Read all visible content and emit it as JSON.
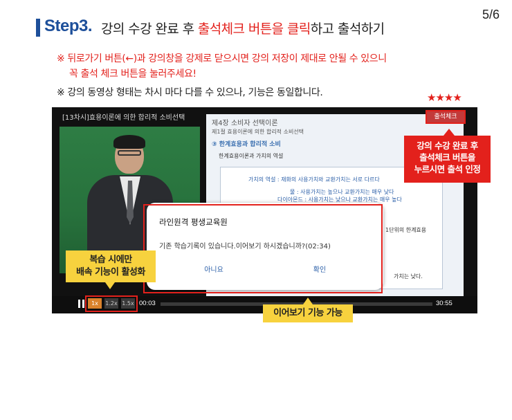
{
  "header": {
    "step_label": "Step3.",
    "title_before": "강의 수강 완료 후 ",
    "title_highlight": "출석체크 버튼을 클릭",
    "title_after": "하고 출석하기",
    "page_number": "5/6"
  },
  "notes": {
    "warning_line1": "※ 뒤로가기 버튼(←)과 강의창을 강제로 닫으시면 강의 저장이 제대로 안될 수 있으니",
    "warning_line2": "꼭 출석 체크 버튼을 눌러주세요!",
    "info": "※ 강의 동영상 형태는 차시 마다 다를 수 있으나, 기능은 동일합니다."
  },
  "stars": "★★★★",
  "player": {
    "video_title": "[13차시]효용이론에 의한 합리적 소비선택",
    "checkin_button": "출석체크",
    "slide": {
      "chapter": "제4장 소비자 선택이론",
      "section_title": "제1절 효용이론에 의한 합리적 소비선택",
      "heading": "③ 한계효용과 합리적 소비",
      "subheading": "한계효용이론과 가치의 역설",
      "line1": "가치의 역설 : 재화의 사용가치와 교환가치는 서로 다르다",
      "line2": "물 : 사용가치는 높으나 교환가치는 매우 낮다",
      "line3": "다이아몬드 : 사용가치는 낮으나 교환가치는 매우 높다",
      "line4": "1단위의 한계효용",
      "line5": "가치는 낮다."
    },
    "dialog": {
      "title": "라인원격 평생교육원",
      "message": "기존 학습기록이 있습니다.이어보기 하시겠습니까?(02:34)",
      "no_label": "아니요",
      "ok_label": "확인"
    },
    "controls": {
      "speeds": [
        "1x",
        "1.2x",
        "1.5x"
      ],
      "active_speed": "1x",
      "current_time": "00:03",
      "total_time": "30:55",
      "progress_fraction": 0.0
    }
  },
  "callouts": {
    "checkin_line1": "강의 수강 완료 후",
    "checkin_line2": "출석체크 버튼을",
    "checkin_line3": "누르시면 출석 인정",
    "review_line1": "복습 시에만",
    "review_line2": "배속 기능이 활성화",
    "resume": "이어보기 기능 가능"
  },
  "colors": {
    "accent_blue": "#1d4f9a",
    "accent_red": "#e3211c",
    "callout_yellow": "#f7d23e"
  }
}
